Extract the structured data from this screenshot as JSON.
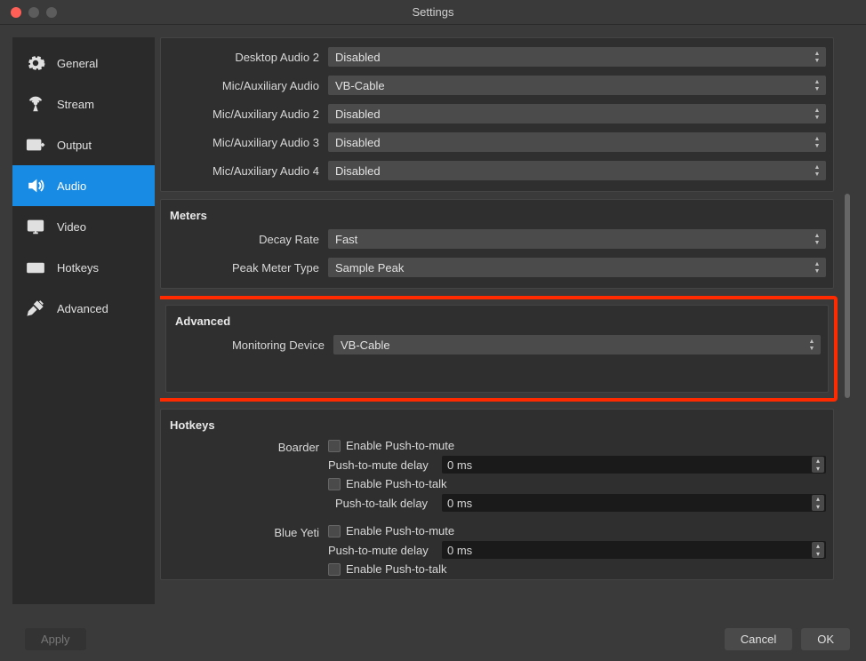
{
  "window": {
    "title": "Settings"
  },
  "sidebar": {
    "items": [
      {
        "label": "General",
        "icon": "gear-icon"
      },
      {
        "label": "Stream",
        "icon": "antenna-icon"
      },
      {
        "label": "Output",
        "icon": "output-icon"
      },
      {
        "label": "Audio",
        "icon": "speaker-icon",
        "active": true
      },
      {
        "label": "Video",
        "icon": "monitor-icon"
      },
      {
        "label": "Hotkeys",
        "icon": "keyboard-icon"
      },
      {
        "label": "Advanced",
        "icon": "tools-icon"
      }
    ]
  },
  "devices": {
    "rows": [
      {
        "label": "Desktop Audio 2",
        "value": "Disabled"
      },
      {
        "label": "Mic/Auxiliary Audio",
        "value": "VB-Cable"
      },
      {
        "label": "Mic/Auxiliary Audio 2",
        "value": "Disabled"
      },
      {
        "label": "Mic/Auxiliary Audio 3",
        "value": "Disabled"
      },
      {
        "label": "Mic/Auxiliary Audio 4",
        "value": "Disabled"
      }
    ]
  },
  "meters": {
    "header": "Meters",
    "decay_rate": {
      "label": "Decay Rate",
      "value": "Fast"
    },
    "peak_meter_type": {
      "label": "Peak Meter Type",
      "value": "Sample Peak"
    }
  },
  "advanced": {
    "header": "Advanced",
    "monitoring_device": {
      "label": "Monitoring Device",
      "value": "VB-Cable"
    }
  },
  "hotkeys": {
    "header": "Hotkeys",
    "groups": [
      {
        "name": "Boarder",
        "push_to_mute_enable": "Enable Push-to-mute",
        "push_to_mute_delay_label": "Push-to-mute delay",
        "push_to_mute_delay_value": "0 ms",
        "push_to_talk_enable": "Enable Push-to-talk",
        "push_to_talk_delay_label": "Push-to-talk delay",
        "push_to_talk_delay_value": "0 ms"
      },
      {
        "name": "Blue Yeti",
        "push_to_mute_enable": "Enable Push-to-mute",
        "push_to_mute_delay_label": "Push-to-mute delay",
        "push_to_mute_delay_value": "0 ms",
        "push_to_talk_enable": "Enable Push-to-talk"
      }
    ]
  },
  "footer": {
    "apply": "Apply",
    "cancel": "Cancel",
    "ok": "OK"
  }
}
